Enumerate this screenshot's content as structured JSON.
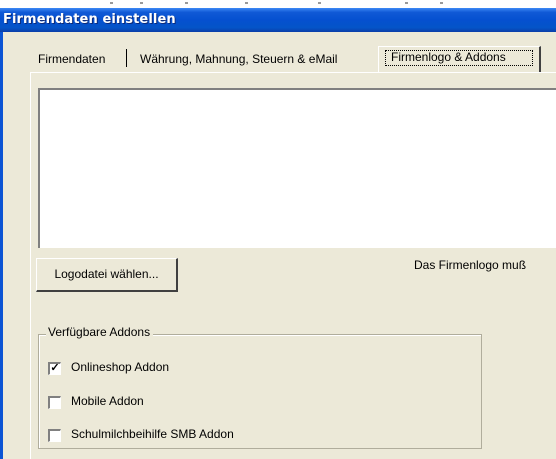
{
  "window": {
    "title": "Firmendaten einstellen"
  },
  "tabs": [
    {
      "label": "Firmendaten",
      "active": false
    },
    {
      "label": "Währung, Mahnung, Steuern & eMail",
      "active": false
    },
    {
      "label": "Firmenlogo & Addons",
      "active": true
    }
  ],
  "logo": {
    "choose_button": "Logodatei wählen...",
    "info_text": "Das Firmenlogo muß"
  },
  "addons": {
    "group_label": "Verfügbare Addons",
    "items": [
      {
        "label": "Onlineshop Addon",
        "checked": true
      },
      {
        "label": "Mobile Addon",
        "checked": false
      },
      {
        "label": "Schulmilchbeihilfe SMB Addon",
        "checked": false
      }
    ]
  },
  "colors": {
    "titlebar": "#0550d0",
    "dialog_face": "#ece9d8"
  }
}
